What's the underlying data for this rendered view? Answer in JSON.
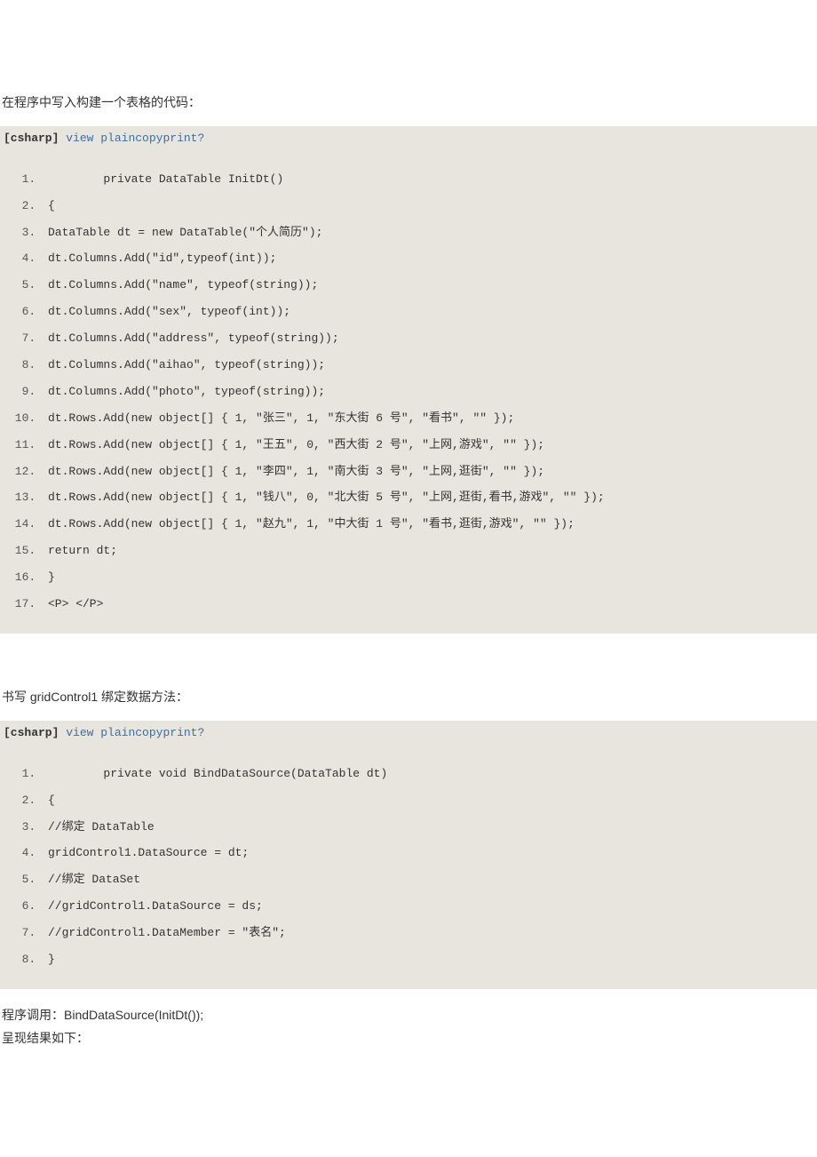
{
  "intro1": "在程序中写入构建一个表格的代码：",
  "block1": {
    "lang": "[csharp]",
    "links": {
      "view": "view plain",
      "copy": "copy",
      "print": "print",
      "q": "?"
    },
    "lines": [
      "        private DataTable InitDt()  ",
      "{  ",
      "DataTable dt = new DataTable(\"个人简历\");  ",
      "dt.Columns.Add(\"id\",typeof(int));  ",
      "dt.Columns.Add(\"name\", typeof(string));  ",
      "dt.Columns.Add(\"sex\", typeof(int));  ",
      "dt.Columns.Add(\"address\", typeof(string));  ",
      "dt.Columns.Add(\"aihao\", typeof(string));  ",
      "dt.Columns.Add(\"photo\", typeof(string));  ",
      "dt.Rows.Add(new object[] { 1, \"张三\", 1, \"东大街 6 号\", \"看书\", \"\" });  ",
      "dt.Rows.Add(new object[] { 1, \"王五\", 0, \"西大街 2 号\", \"上网,游戏\", \"\" });  ",
      "dt.Rows.Add(new object[] { 1, \"李四\", 1, \"南大街 3 号\", \"上网,逛街\", \"\" });  ",
      "dt.Rows.Add(new object[] { 1, \"钱八\", 0, \"北大街 5 号\", \"上网,逛街,看书,游戏\", \"\" });  ",
      "dt.Rows.Add(new object[] { 1, \"赵九\", 1, \"中大街 1 号\", \"看书,逛街,游戏\", \"\" });  ",
      "return dt;  ",
      "}  ",
      "<P> </P>  "
    ]
  },
  "intro2": "书写 gridControl1 绑定数据方法：",
  "block2": {
    "lang": "[csharp]",
    "links": {
      "view": "view plain",
      "copy": "copy",
      "print": "print",
      "q": "?"
    },
    "lines": [
      "        private void BindDataSource(DataTable dt)  ",
      "{  ",
      "//绑定 DataTable  ",
      "gridControl1.DataSource = dt;  ",
      "//绑定 DataSet  ",
      "//gridControl1.DataSource = ds;  ",
      "//gridControl1.DataMember = \"表名\";  ",
      "}  "
    ]
  },
  "outro1": "程序调用：BindDataSource(InitDt());",
  "outro2": "呈现结果如下："
}
